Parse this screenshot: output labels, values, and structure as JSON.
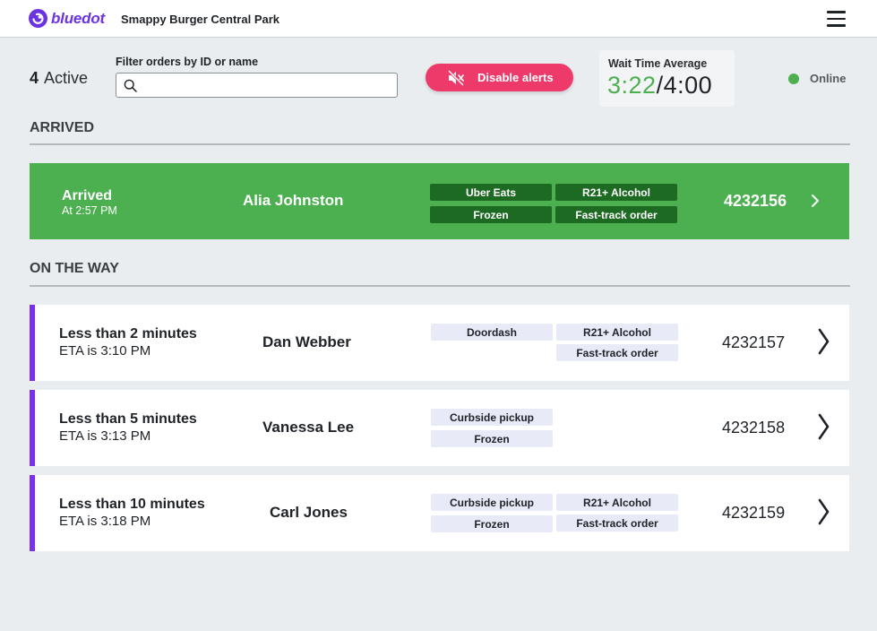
{
  "header": {
    "brand": "bluedot",
    "store": "Smappy Burger Central Park",
    "brand_color": "#6b34e0"
  },
  "toolbar": {
    "active_count": "4",
    "active_label": "Active",
    "filter_label": "Filter orders by ID or name",
    "search_value": "",
    "alerts_button": "Disable alerts",
    "wait_label": "Wait Time Average",
    "wait_current": "3:22",
    "wait_target": "/4:00",
    "online_label": "Online"
  },
  "colors": {
    "arrived": "#4caf50",
    "accent": "#7b2ff0",
    "alert": "#ee3a6a"
  },
  "sections": {
    "arrived": "ARRIVED",
    "on_the_way": "ON THE WAY"
  },
  "arrived_orders": [
    {
      "status": "Arrived",
      "sub": "At 2:57 PM",
      "name": "Alia Johnston",
      "tags": [
        "Uber Eats",
        "R21+ Alcohol",
        "Frozen",
        "Fast-track order"
      ],
      "order_id": "4232156"
    }
  ],
  "on_the_way_orders": [
    {
      "status": "Less than 2 minutes",
      "sub": "ETA is 3:10 PM",
      "name": "Dan Webber",
      "tags": [
        "Doordash",
        "R21+ Alcohol",
        "Fast-track order"
      ],
      "order_id": "4232157"
    },
    {
      "status": "Less than 5 minutes",
      "sub": "ETA is 3:13 PM",
      "name": "Vanessa Lee",
      "tags": [
        "Curbside pickup",
        "Frozen"
      ],
      "order_id": "4232158"
    },
    {
      "status": "Less than 10 minutes",
      "sub": "ETA is 3:18 PM",
      "name": "Carl Jones",
      "tags": [
        "Curbside pickup",
        "R21+ Alcohol",
        "Frozen",
        "Fast-track order"
      ],
      "order_id": "4232159"
    }
  ]
}
